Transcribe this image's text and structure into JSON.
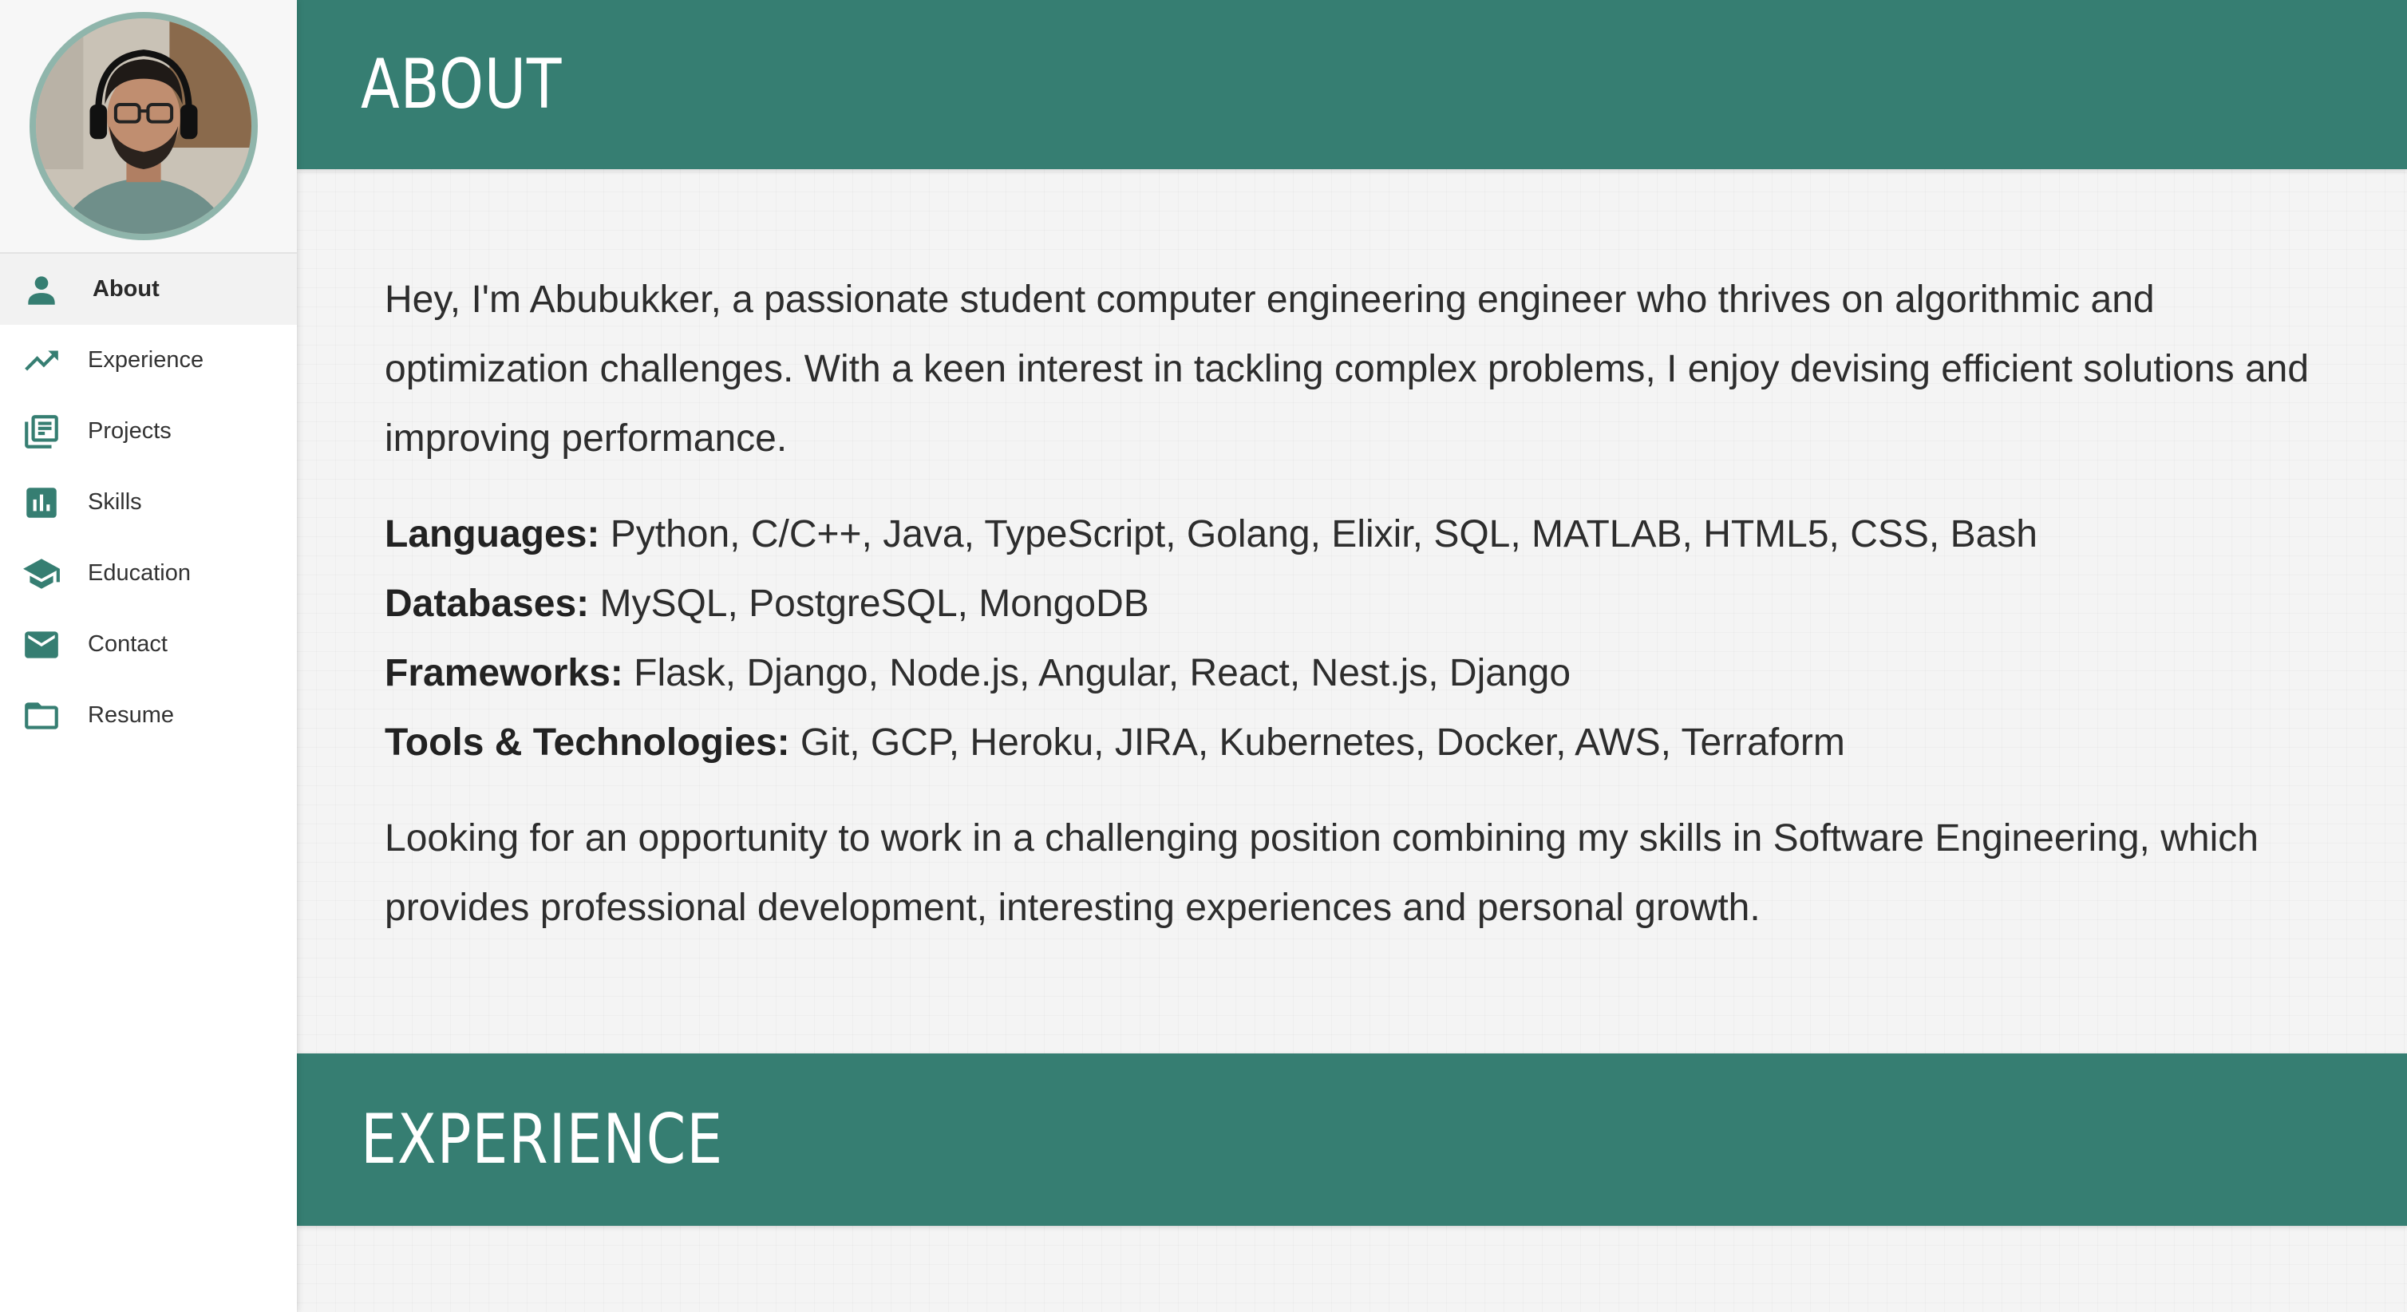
{
  "sidebar": {
    "avatar_alt": "profile photo",
    "items": [
      {
        "label": "About",
        "icon": "person-icon",
        "active": true
      },
      {
        "label": "Experience",
        "icon": "trending-up-icon",
        "active": false
      },
      {
        "label": "Projects",
        "icon": "newspaper-icon",
        "active": false
      },
      {
        "label": "Skills",
        "icon": "bar-chart-icon",
        "active": false
      },
      {
        "label": "Education",
        "icon": "school-icon",
        "active": false
      },
      {
        "label": "Contact",
        "icon": "mail-icon",
        "active": false
      },
      {
        "label": "Resume",
        "icon": "folder-icon",
        "active": false
      }
    ]
  },
  "about": {
    "title": "ABOUT",
    "intro": "Hey, I'm Abubukker, a passionate student computer engineering engineer who thrives on algorithmic and optimization challenges. With a keen interest in tackling complex problems, I enjoy devising efficient solutions and improving performance.",
    "skills": [
      {
        "key": "Languages:",
        "value": " Python, C/C++, Java, TypeScript, Golang, Elixir, SQL, MATLAB, HTML5, CSS, Bash"
      },
      {
        "key": "Databases:",
        "value": " MySQL, PostgreSQL, MongoDB"
      },
      {
        "key": "Frameworks:",
        "value": " Flask, Django, Node.js, Angular, React, Nest.js, Django"
      },
      {
        "key": "Tools & Technologies:",
        "value": " Git, GCP, Heroku, JIRA, Kubernetes, Docker, AWS, Terraform"
      }
    ],
    "closing": "Looking for an opportunity to work in a challenging position combining my skills in Software Engineering, which provides professional development, interesting experiences and personal growth."
  },
  "experience": {
    "title": "EXPERIENCE"
  },
  "colors": {
    "accent": "#367e72",
    "avatar_ring": "#8fb5ab",
    "sidebar_bg": "#ffffff",
    "page_bg": "#f4f4f4"
  }
}
